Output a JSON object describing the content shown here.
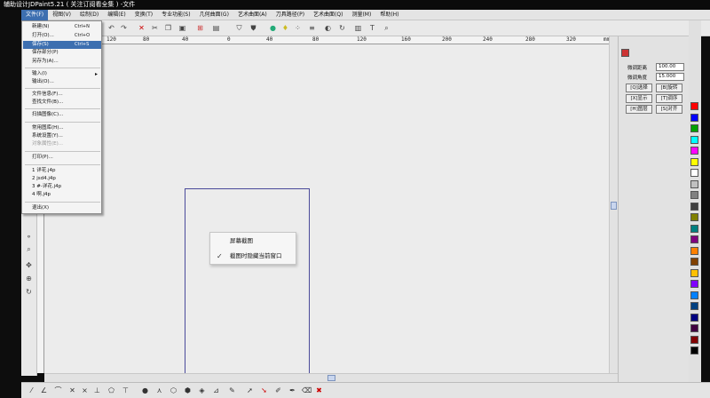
{
  "window": {
    "title": "辅助设计JDPaint5.21 ( 关注订阅看全集 ) -文件"
  },
  "menubar": {
    "items": [
      "文件(F)",
      "视图(V)",
      "绘制(D)",
      "编辑(E)",
      "变换(T)",
      "专业功能(S)",
      "几何曲面(G)",
      "艺术曲面(A)",
      "刀具路径(P)",
      "艺术曲面(Q)",
      "测量(M)",
      "帮助(H)"
    ]
  },
  "file_menu": {
    "new": {
      "label": "新建(N)",
      "shortcut": "Ctrl+N"
    },
    "open": {
      "label": "打开(O)...",
      "shortcut": "Ctrl+O"
    },
    "save": {
      "label": "保存(S)",
      "shortcut": "Ctrl+S"
    },
    "save_part": {
      "label": "保存部分(P)"
    },
    "save_as": {
      "label": "另存为(A)..."
    },
    "import": {
      "label": "输入(I)"
    },
    "export": {
      "label": "输出(O)..."
    },
    "file_info": {
      "label": "文件信息(F)..."
    },
    "find_file": {
      "label": "查找文件(B)..."
    },
    "scan": {
      "label": "扫描图像(C)..."
    },
    "common_library": {
      "label": "常用图库(H)..."
    },
    "system_settings": {
      "label": "系统设置(Y)..."
    },
    "object_props": {
      "label": "对象属性(E)..."
    },
    "print": {
      "label": "打印(P)..."
    },
    "recent": [
      "1 详花.j4p",
      "2 jsd4.j4p",
      "3 #-详花.j4p",
      "4 啊.j4p"
    ],
    "exit": {
      "label": "退出(X)"
    }
  },
  "ruler_top": {
    "ticks": [
      "120",
      "80",
      "40",
      "0",
      "40",
      "80",
      "120",
      "160",
      "200",
      "240",
      "280",
      "320"
    ],
    "unit": "mm"
  },
  "context_menu": {
    "title": "屏幕截图",
    "items": [
      {
        "label": "截图时隐藏当前窗口",
        "checked": true
      }
    ]
  },
  "right_panel": {
    "step_distance_label": "微调距离",
    "step_distance_value": "100.00",
    "step_angle_label": "微调角度",
    "step_angle_value": "15.000",
    "buttons": [
      "[Q]选择",
      "[B]旋转",
      "[X]显示",
      "[T]调序",
      "[H]图层",
      "[S]对齐"
    ]
  },
  "palette": {
    "colors": [
      "#ff0000",
      "#0000ff",
      "#00a000",
      "#00ffff",
      "#ff00ff",
      "#ffff00",
      "#ffffff",
      "#c0c0c0",
      "#808080",
      "#404040",
      "#808000",
      "#008080",
      "#800080",
      "#ff8000",
      "#804000",
      "#ffc000",
      "#8000ff",
      "#0080ff",
      "#004080",
      "#000080",
      "#400040",
      "#800000",
      "#000000"
    ]
  }
}
